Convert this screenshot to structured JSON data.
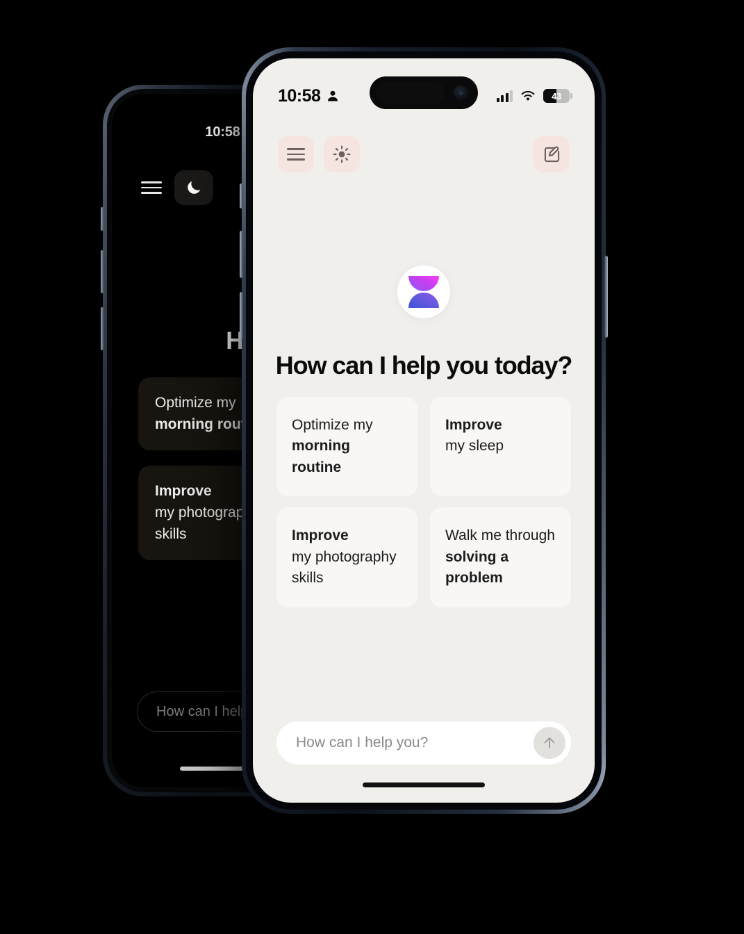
{
  "app": {
    "title": "How can I help you today?",
    "logo_icon": "hourglass-logo",
    "logo_gradient_from": "#e838f5",
    "logo_gradient_to": "#3f53d9",
    "accent_button_bg": "#f6e4e0",
    "screen_bg_light": "#f0efec",
    "screen_bg_dark": "#000000",
    "card_bg_light": "#f8f7f5",
    "card_bg_dark": "#18140f"
  },
  "status_bar": {
    "time": "10:58",
    "person_icon": "person-icon",
    "signal_icon": "cellular-signal-icon",
    "wifi_icon": "wifi-icon",
    "battery_icon": "battery-icon",
    "battery_percent": "43"
  },
  "header": {
    "menu_icon": "hamburger-menu-icon",
    "theme_light_icon": "sun-icon",
    "theme_dark_icon": "moon-icon",
    "compose_icon": "compose-edit-icon"
  },
  "suggestions": [
    {
      "line1": "Optimize my",
      "line1_bold": false,
      "line2": "morning routine",
      "line2_bold": true,
      "line3": ""
    },
    {
      "line1": "Improve",
      "line1_bold": true,
      "line2": "my sleep",
      "line2_bold": false,
      "line3": ""
    },
    {
      "line1": "Improve",
      "line1_bold": true,
      "line2": "my photography",
      "line2_bold": false,
      "line3": "skills"
    },
    {
      "line1": "Walk me through",
      "line1_bold": false,
      "line2": "solving a problem",
      "line2_bold": true,
      "line3": ""
    }
  ],
  "composer": {
    "placeholder": "How can I help you?",
    "send_icon": "arrow-up-icon"
  },
  "dark_phone": {
    "title": "How can",
    "cards": [
      {
        "line1": "Optimize my",
        "line1_bold": false,
        "line2": "morning routine",
        "line2_bold": true,
        "line3": ""
      },
      {
        "line1": "Improve",
        "line1_bold": true,
        "line2": "my photography",
        "line2_bold": false,
        "line3": "skills"
      }
    ],
    "composer_placeholder": "How can I help yo"
  }
}
